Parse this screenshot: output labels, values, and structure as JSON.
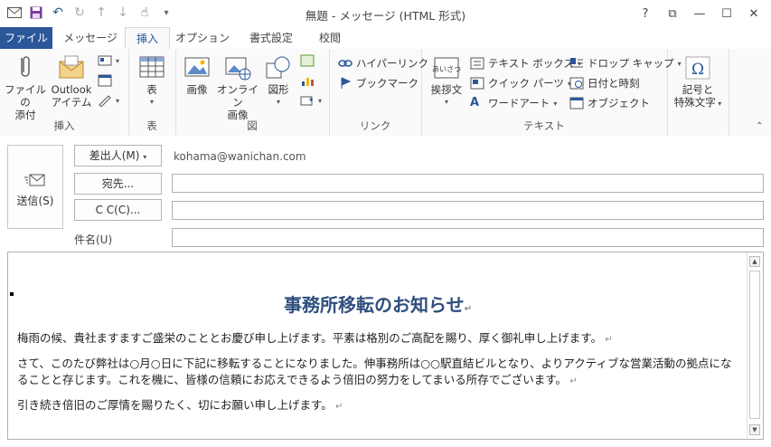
{
  "window": {
    "title": "無題 - メッセージ (HTML 形式)",
    "help": "?",
    "restore_ribbon": "⧉",
    "minimize": "—",
    "maximize": "☐",
    "close": "✕"
  },
  "tabs": [
    {
      "label": "ファイル"
    },
    {
      "label": "メッセージ"
    },
    {
      "label": "挿入"
    },
    {
      "label": "オプション"
    },
    {
      "label": "書式設定"
    },
    {
      "label": "校閲"
    }
  ],
  "ribbon": {
    "group_insert": {
      "label": "挿入",
      "attach_file": [
        "ファイルの",
        "添付"
      ],
      "outlook_item": [
        "Outlook",
        "アイテム"
      ]
    },
    "group_table": {
      "label": "表",
      "table": "表"
    },
    "group_illust": {
      "label": "図",
      "picture": "画像",
      "online_picture": [
        "オンライン",
        "画像"
      ],
      "shapes": "図形"
    },
    "group_link": {
      "label": "リンク",
      "hyperlink": "ハイパーリンク",
      "bookmark": "ブックマーク"
    },
    "group_text": {
      "label": "テキスト",
      "greeting": "挨拶文",
      "textbox": "テキスト ボックス",
      "quickparts": "クイック パーツ",
      "wordart": "ワードアート",
      "dropcap": "ドロップ キャップ",
      "datetime": "日付と時刻",
      "object": "オブジェクト"
    },
    "group_symbol": {
      "symbol": [
        "記号と",
        "特殊文字"
      ]
    }
  },
  "compose": {
    "send": "送信(S)",
    "from_button": "差出人(M)",
    "from_value": "kohama@wanichan.com",
    "to_button": "宛先...",
    "cc_button": "C C(C)...",
    "subject_label": "件名(U)",
    "to_value": "",
    "cc_value": "",
    "subject_value": ""
  },
  "message": {
    "title": "事務所移転のお知らせ",
    "paragraphs": [
      "梅雨の候、貴社ますますご盛栄のこととお慶び申し上げます。平素は格別のご高配を賜り、厚く御礼申し上げます。",
      "さて、このたび弊社は○月○日に下記に移転することになりました。伸事務所は○○駅直結ビルとなり、よりアクティブな営業活動の拠点になることと存じます。これを機に、皆様の信頼にお応えできるよう倍旧の努力をしてまいる所存でございます。",
      "引き続き倍旧のご厚情を賜りたく、切にお願い申し上げます。"
    ]
  },
  "colors": {
    "accent": "#2b579a",
    "title_text": "#2f4f7e"
  }
}
